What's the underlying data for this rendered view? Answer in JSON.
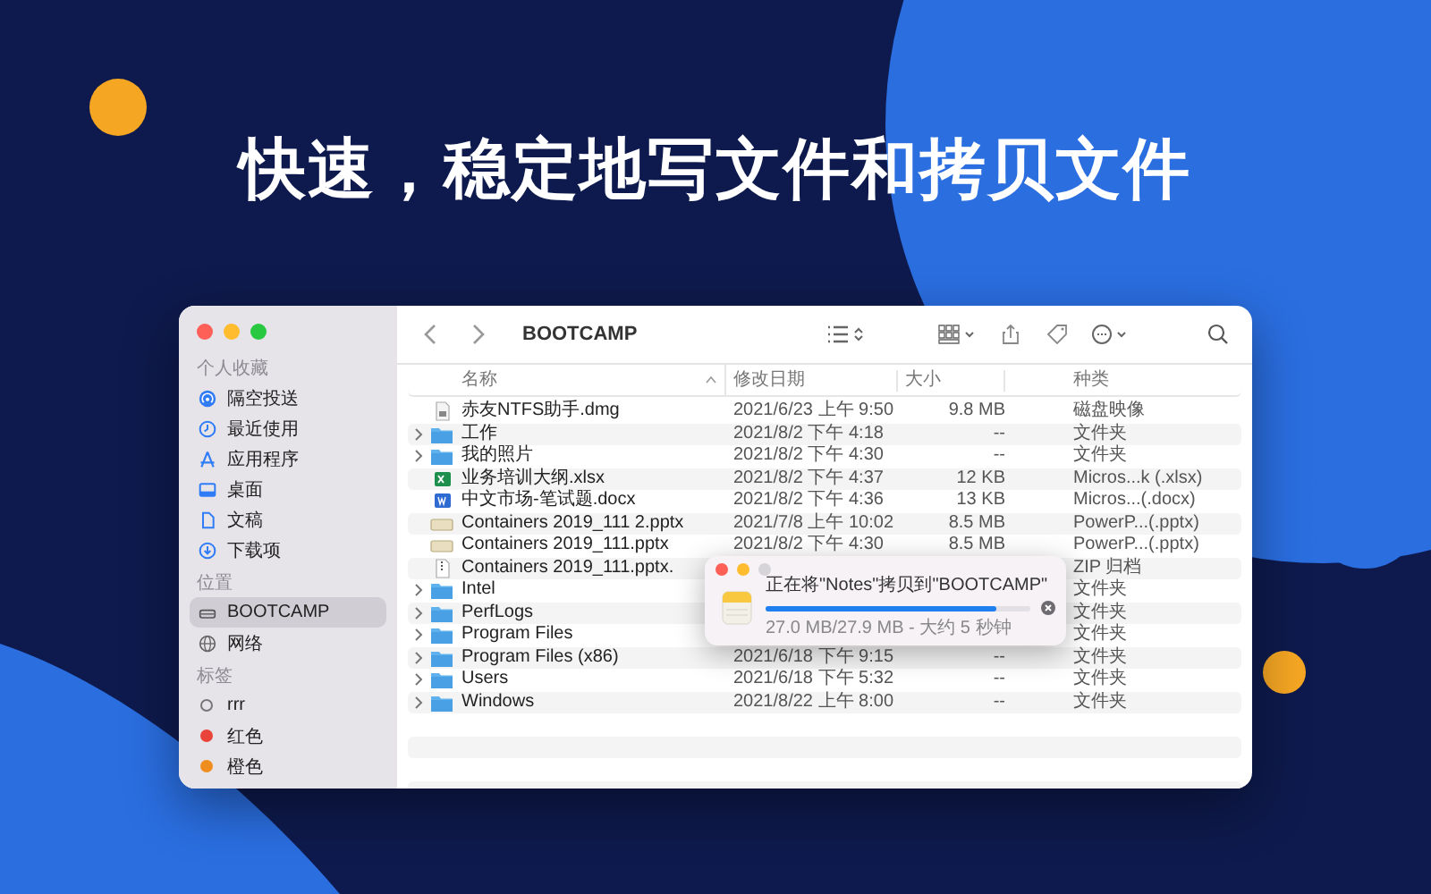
{
  "headline": "快速，稳定地写文件和拷贝文件",
  "finder": {
    "sidebar": {
      "sections": [
        {
          "heading": "个人收藏",
          "items": [
            {
              "label": "隔空投送",
              "selected": false
            },
            {
              "label": "最近使用",
              "selected": false
            },
            {
              "label": "应用程序",
              "selected": false
            },
            {
              "label": "桌面",
              "selected": false
            },
            {
              "label": "文稿",
              "selected": false
            },
            {
              "label": "下载项",
              "selected": false
            }
          ]
        },
        {
          "heading": "位置",
          "items": [
            {
              "label": "BOOTCAMP",
              "selected": true
            },
            {
              "label": "网络",
              "selected": false
            }
          ]
        },
        {
          "heading": "标签",
          "items": [
            {
              "label": "rrr",
              "selected": false
            },
            {
              "label": "红色",
              "selected": false,
              "color": "#e9433a"
            },
            {
              "label": "橙色",
              "selected": false,
              "color": "#ef8e1e"
            }
          ]
        }
      ]
    },
    "toolbar": {
      "title": "BOOTCAMP"
    },
    "table": {
      "columns": [
        {
          "label": "名称",
          "sorted": true
        },
        {
          "label": "修改日期",
          "sorted": false
        },
        {
          "label": "大小",
          "sorted": false
        },
        {
          "label": "种类",
          "sorted": false
        }
      ],
      "rows": [
        {
          "kind": "disk-image",
          "name": "赤友NTFS助手.dmg",
          "date": "2021/6/23 上午 9:50",
          "size": "9.8 MB",
          "type": "磁盘映像"
        },
        {
          "kind": "folder",
          "name": "工作",
          "date": "2021/8/2 下午 4:18",
          "size": "--",
          "type": "文件夹"
        },
        {
          "kind": "folder",
          "name": "我的照片",
          "date": "2021/8/2 下午 4:30",
          "size": "--",
          "type": "文件夹"
        },
        {
          "kind": "spreadsheet",
          "name": "业务培训大纲.xlsx",
          "date": "2021/8/2 下午 4:37",
          "size": "12 KB",
          "type": "Micros...k (.xlsx)"
        },
        {
          "kind": "document",
          "name": "中文市场-笔试题.docx",
          "date": "2021/8/2 下午 4:36",
          "size": "13 KB",
          "type": "Micros...(.docx)"
        },
        {
          "kind": "presentation",
          "name": "Containers 2019_111 2.pptx",
          "date": "2021/7/8 上午 10:02",
          "size": "8.5 MB",
          "type": "PowerP...(.pptx)"
        },
        {
          "kind": "presentation",
          "name": "Containers 2019_111.pptx",
          "date": "2021/8/2 下午 4:30",
          "size": "8.5 MB",
          "type": "PowerP...(.pptx)"
        },
        {
          "kind": "archive",
          "name": "Containers 2019_111.pptx.",
          "type": "ZIP 归档"
        },
        {
          "kind": "folder",
          "name": "Intel",
          "type": "文件夹"
        },
        {
          "kind": "folder",
          "name": "PerfLogs",
          "type": "文件夹"
        },
        {
          "kind": "folder",
          "name": "Program Files",
          "type": "文件夹"
        },
        {
          "kind": "folder",
          "name": "Program Files (x86)",
          "date": "2021/6/18 下午 9:15",
          "size": "--",
          "type": "文件夹"
        },
        {
          "kind": "folder",
          "name": "Users",
          "date": "2021/6/18 下午 5:32",
          "size": "--",
          "type": "文件夹"
        },
        {
          "kind": "folder",
          "name": "Windows",
          "date": "2021/8/22 上午 8:00",
          "size": "--",
          "type": "文件夹"
        }
      ]
    }
  },
  "copy_dialog": {
    "title": "正在将\"Notes\"拷贝到\"BOOTCAMP\"",
    "level": 0.87,
    "status": "27.0 MB/27.9 MB - 大约 5 秒钟"
  }
}
